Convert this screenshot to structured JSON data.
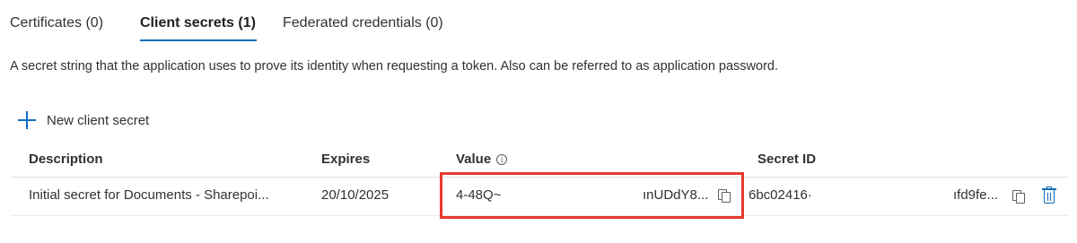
{
  "tabs": [
    {
      "label": "Certificates (0)",
      "active": false
    },
    {
      "label": "Client secrets (1)",
      "active": true
    },
    {
      "label": "Federated credentials (0)",
      "active": false
    }
  ],
  "description": "A secret string that the application uses to prove its identity when requesting a token. Also can be referred to as application password.",
  "new_secret_label": "New client secret",
  "table": {
    "headers": {
      "description": "Description",
      "expires": "Expires",
      "value": "Value",
      "secret_id": "Secret ID"
    },
    "value_info_glyph": "i",
    "rows": [
      {
        "description": "Initial secret for Documents - Sharepoi...",
        "expires": "20/10/2025",
        "value_start": "4-48Q~",
        "value_end": "ınUDdY8...",
        "secret_id_start": "6bc02416·",
        "secret_id_end": "ıfd9fe..."
      }
    ]
  },
  "icons": {
    "add": "plus-icon",
    "info": "info-icon",
    "copy": "copy-icon",
    "delete": "trash-icon"
  },
  "colors": {
    "accent": "#0f6cbd",
    "highlight": "#e53a2f"
  }
}
